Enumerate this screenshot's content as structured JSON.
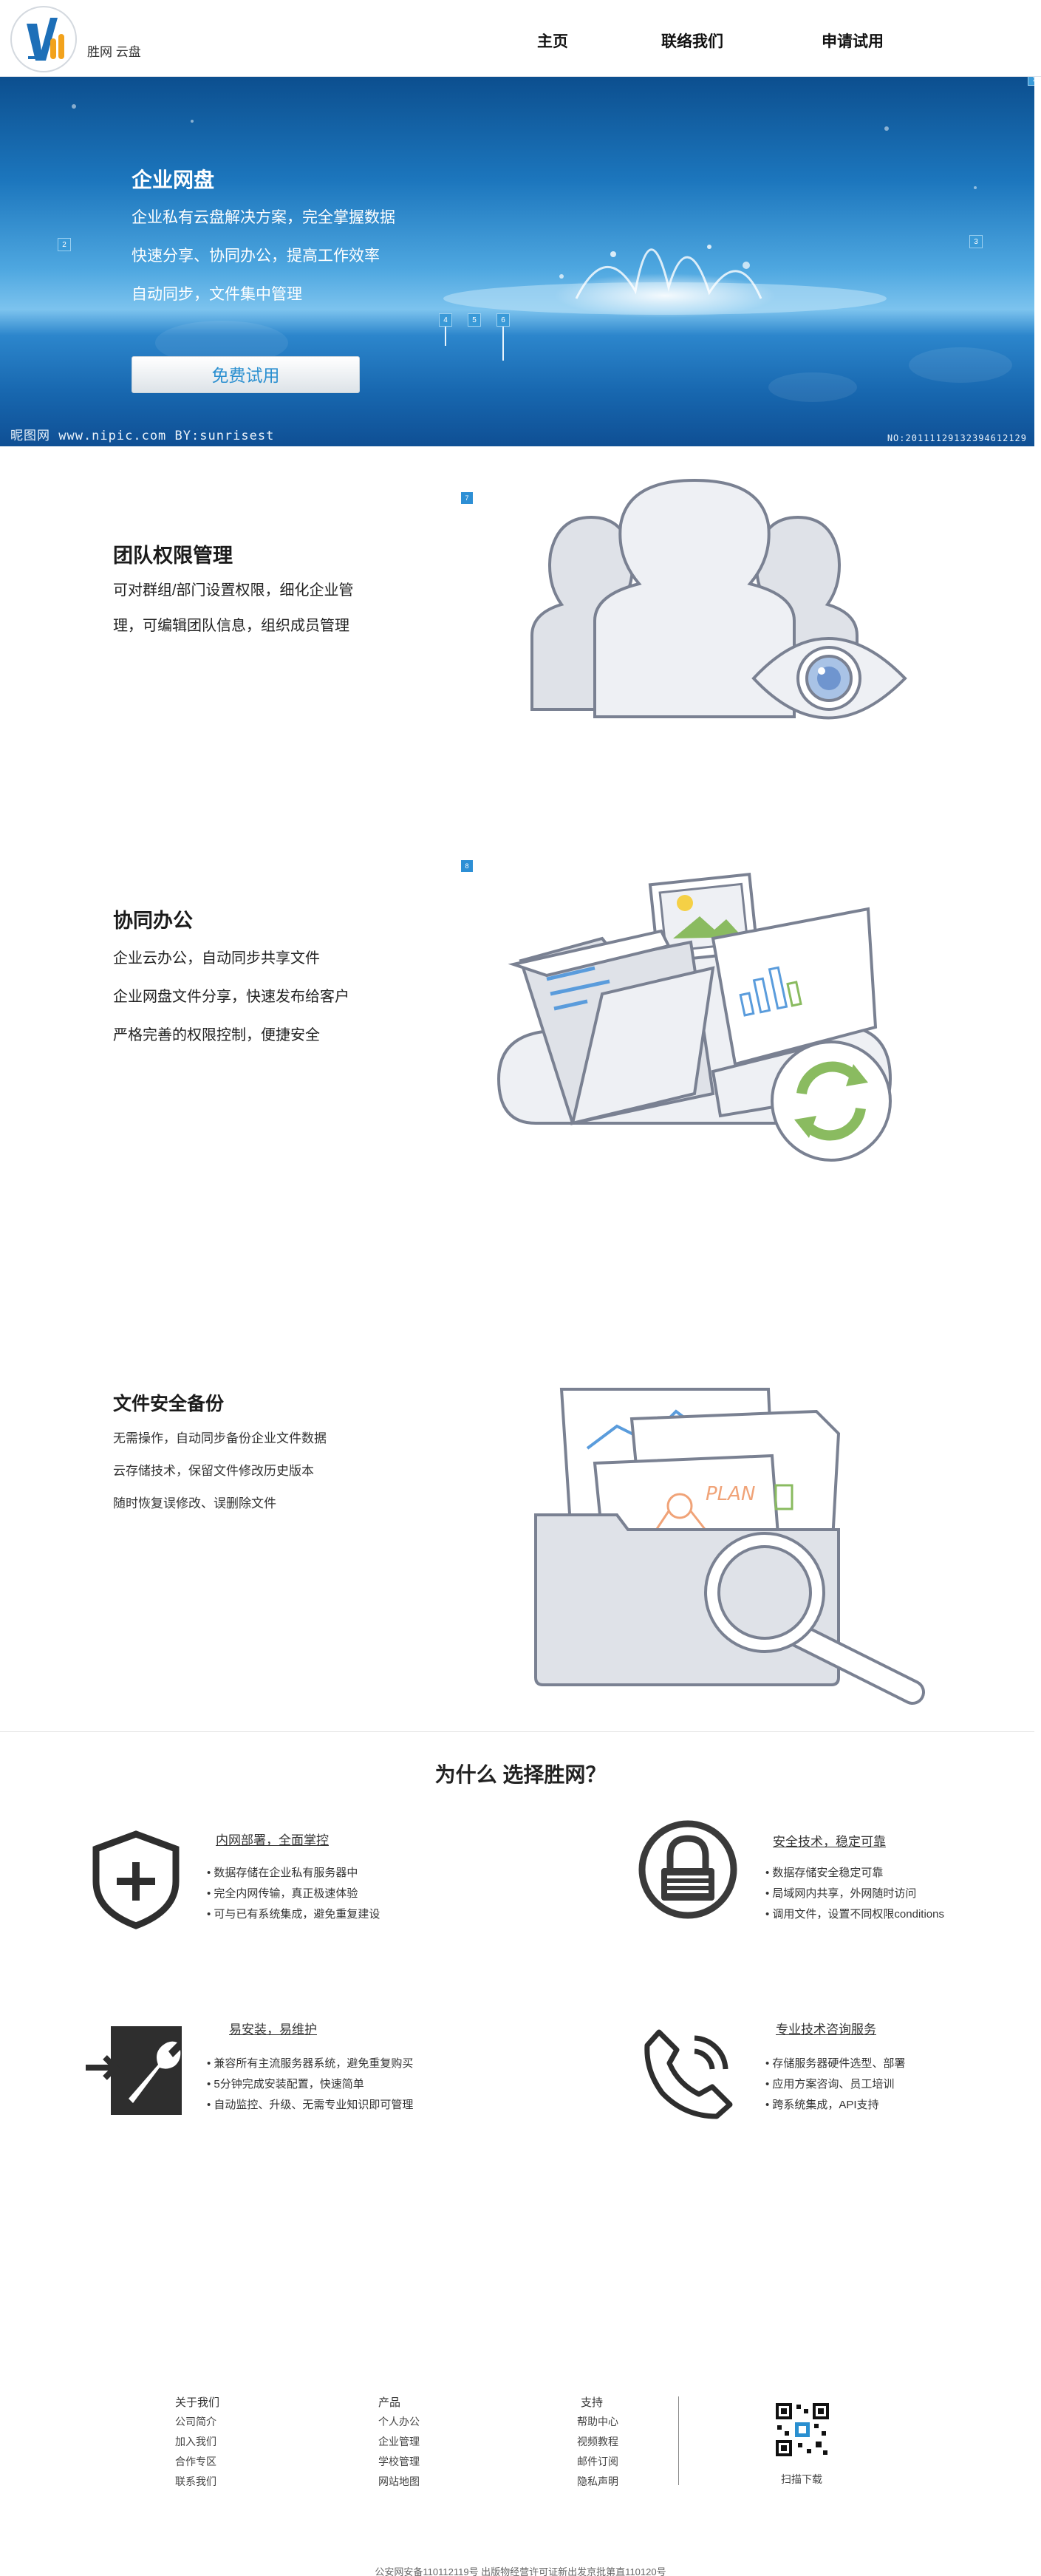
{
  "header": {
    "brand": "胜网 云盘",
    "nav": [
      "主页",
      "联络我们",
      "申请试用"
    ]
  },
  "banner": {
    "title": "企业网盘",
    "lines": [
      "企业私有云盘解决方案，完全掌握数据",
      "快速分享、协同办公，提高工作效率",
      "自动同步，文件集中管理"
    ],
    "button": "免费试用",
    "markers": [
      "1",
      "2",
      "3",
      "4",
      "5",
      "6"
    ],
    "watermark_left": "昵图网 www.nipic.com   BY:sunrisest",
    "watermark_right": "NO:20111129132394612129"
  },
  "features": [
    {
      "title": "团队权限管理",
      "lines": [
        "可对群组/部门设置权限，细化企业管",
        "理，可编辑团队信息，组织成员管理"
      ],
      "marker": "7"
    },
    {
      "title": "协同办公",
      "lines": [
        "企业云办公，自动同步共享文件",
        "企业网盘文件分享，快速发布给客户",
        "严格完善的权限控制，便捷安全"
      ],
      "marker": "8"
    },
    {
      "title": "文件安全备份",
      "lines": [
        "无需操作，自动同步备份企业文件数据",
        "云存储技术，保留文件修改历史版本",
        "随时恢复误修改、误删除文件"
      ]
    }
  ],
  "why": {
    "title": "为什么 选择胜网？",
    "blocks": [
      {
        "head": "内网部署，全面掌控",
        "items": [
          "• 数据存储在企业私有服务器中",
          "• 完全内网传输，真正极速体验",
          "• 可与已有系统集成，避免重复建设"
        ],
        "icon": "shield-plus-icon"
      },
      {
        "head": "安全技术，稳定可靠",
        "items": [
          "• 数据存储安全稳定可靠",
          "• 局域网内共享，外网随时访问",
          "• 调用文件，设置不同权限conditions"
        ],
        "icon": "lock-icon"
      },
      {
        "head": "易安装，易维护",
        "items": [
          "• 兼容所有主流服务器系统，避免重复购买",
          "• 5分钟完成安装配置，快速简单",
          "• 自动监控、升级、无需专业知识即可管理"
        ],
        "icon": "wrench-door-icon"
      },
      {
        "head": "专业技术咨询服务",
        "items": [
          "• 存储服务器硬件选型、部署",
          "• 应用方案咨询、员工培训",
          "• 跨系统集成，API支持"
        ],
        "icon": "phone-icon"
      }
    ]
  },
  "footer": {
    "columns": [
      {
        "head": "关于我们",
        "links": [
          "公司简介",
          "加入我们",
          "合作专区",
          "联系我们"
        ]
      },
      {
        "head": "产品",
        "links": [
          "个人办公",
          "企业管理",
          "学校管理",
          "网站地图"
        ]
      },
      {
        "head": "支持",
        "links": [
          "帮助中心",
          "视频教程",
          "邮件订阅",
          "隐私声明"
        ]
      }
    ],
    "qr_label": "扫描下载",
    "copyright": "公安网安备110112119号   出版物经营许可证新出发京批第直110120号"
  },
  "colors": {
    "accent": "#2a8fd0",
    "banner": "#1c76bd",
    "icon_stroke": "#7a8192",
    "icon_fill": "#e4e6ec"
  }
}
